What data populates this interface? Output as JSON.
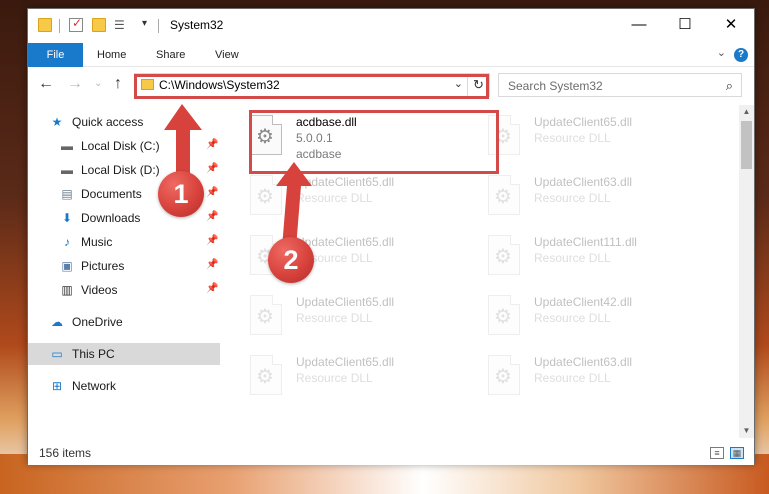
{
  "window": {
    "title": "System32"
  },
  "ribbon": {
    "tabs": [
      "File",
      "Home",
      "Share",
      "View"
    ],
    "help": "?"
  },
  "navigation": {
    "address": "C:\\Windows\\System32",
    "search_placeholder": "Search System32"
  },
  "sidebar": {
    "items": [
      {
        "label": "Quick access",
        "icon": "star-icon"
      },
      {
        "label": "Local Disk (C:)",
        "icon": "drive-icon",
        "pinned": true
      },
      {
        "label": "Local Disk (D:)",
        "icon": "drive-icon",
        "pinned": true
      },
      {
        "label": "Documents",
        "icon": "documents-icon",
        "pinned": true
      },
      {
        "label": "Downloads",
        "icon": "download-icon",
        "pinned": true
      },
      {
        "label": "Music",
        "icon": "music-icon",
        "pinned": true
      },
      {
        "label": "Pictures",
        "icon": "pictures-icon",
        "pinned": true
      },
      {
        "label": "Videos",
        "icon": "videos-icon",
        "pinned": true
      },
      {
        "label": "OneDrive",
        "icon": "cloud-icon"
      },
      {
        "label": "This PC",
        "icon": "computer-icon",
        "selected": true
      },
      {
        "label": "Network",
        "icon": "network-icon"
      }
    ]
  },
  "files": [
    {
      "name": "acdbase.dll",
      "line2": "5.0.0.1",
      "line3": "acdbase"
    },
    {
      "name": "UpdateClient65.dll",
      "line2": "Resource DLL"
    },
    {
      "name": "UpdateClient65.dll",
      "line2": "Resource DLL"
    },
    {
      "name": "UpdateClient63.dll",
      "line2": "Resource DLL"
    },
    {
      "name": "UpdateClient65.dll",
      "line2": "Resource DLL"
    },
    {
      "name": "UpdateClient111.dll",
      "line2": "Resource DLL"
    },
    {
      "name": "UpdateClient65.dll",
      "line2": "Resource DLL"
    },
    {
      "name": "UpdateClient42.dll",
      "line2": "Resource DLL"
    },
    {
      "name": "UpdateClient65.dll",
      "line2": "Resource DLL"
    },
    {
      "name": "UpdateClient63.dll",
      "line2": "Resource DLL"
    }
  ],
  "status": {
    "item_count": "156 items"
  },
  "callouts": [
    "1",
    "2"
  ],
  "colors": {
    "accent": "#1979ca",
    "highlight": "#d44a48",
    "selected": "#d9d9d9"
  }
}
